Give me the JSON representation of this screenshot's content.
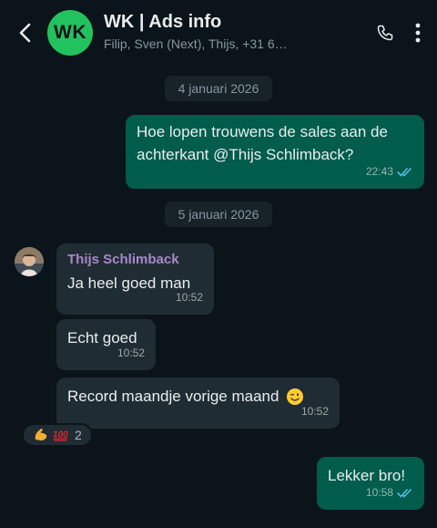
{
  "header": {
    "avatar_initials": "WK",
    "title": "WK | Ads info",
    "subtitle": "Filip, Sven (Next), Thijs, +31 6…",
    "back_icon": "chevron-left-icon",
    "call_icon": "phone-icon",
    "menu_icon": "kebab-menu-icon"
  },
  "dates": {
    "first": "4 januari 2026",
    "second": "5 januari 2026"
  },
  "messages": [
    {
      "direction": "out",
      "line1": "Hoe lopen trouwens de sales aan de",
      "line2": "achterkant @Thijs Schlimback?",
      "time": "22:43",
      "status": "read"
    },
    {
      "direction": "in",
      "sender": "Thijs Schlimback",
      "text": "Ja heel goed man",
      "time": "10:52"
    },
    {
      "direction": "in",
      "text": "Echt goed",
      "time": "10:52"
    },
    {
      "direction": "in",
      "text": "Record maandje vorige maand",
      "time": "10:52"
    },
    {
      "direction": "out",
      "text": "Lekker bro!",
      "time": "10:58",
      "status": "read"
    }
  ],
  "reaction": {
    "emojis": [
      "flexed-biceps",
      "hundred-points"
    ],
    "count": "2"
  },
  "colors": {
    "background": "#0b141a",
    "outgoing_bubble": "#005c4b",
    "incoming_bubble": "#202c33",
    "accent_green": "#22c35e",
    "sender_name": "#a788c9",
    "read_ticks": "#53bdeb"
  }
}
